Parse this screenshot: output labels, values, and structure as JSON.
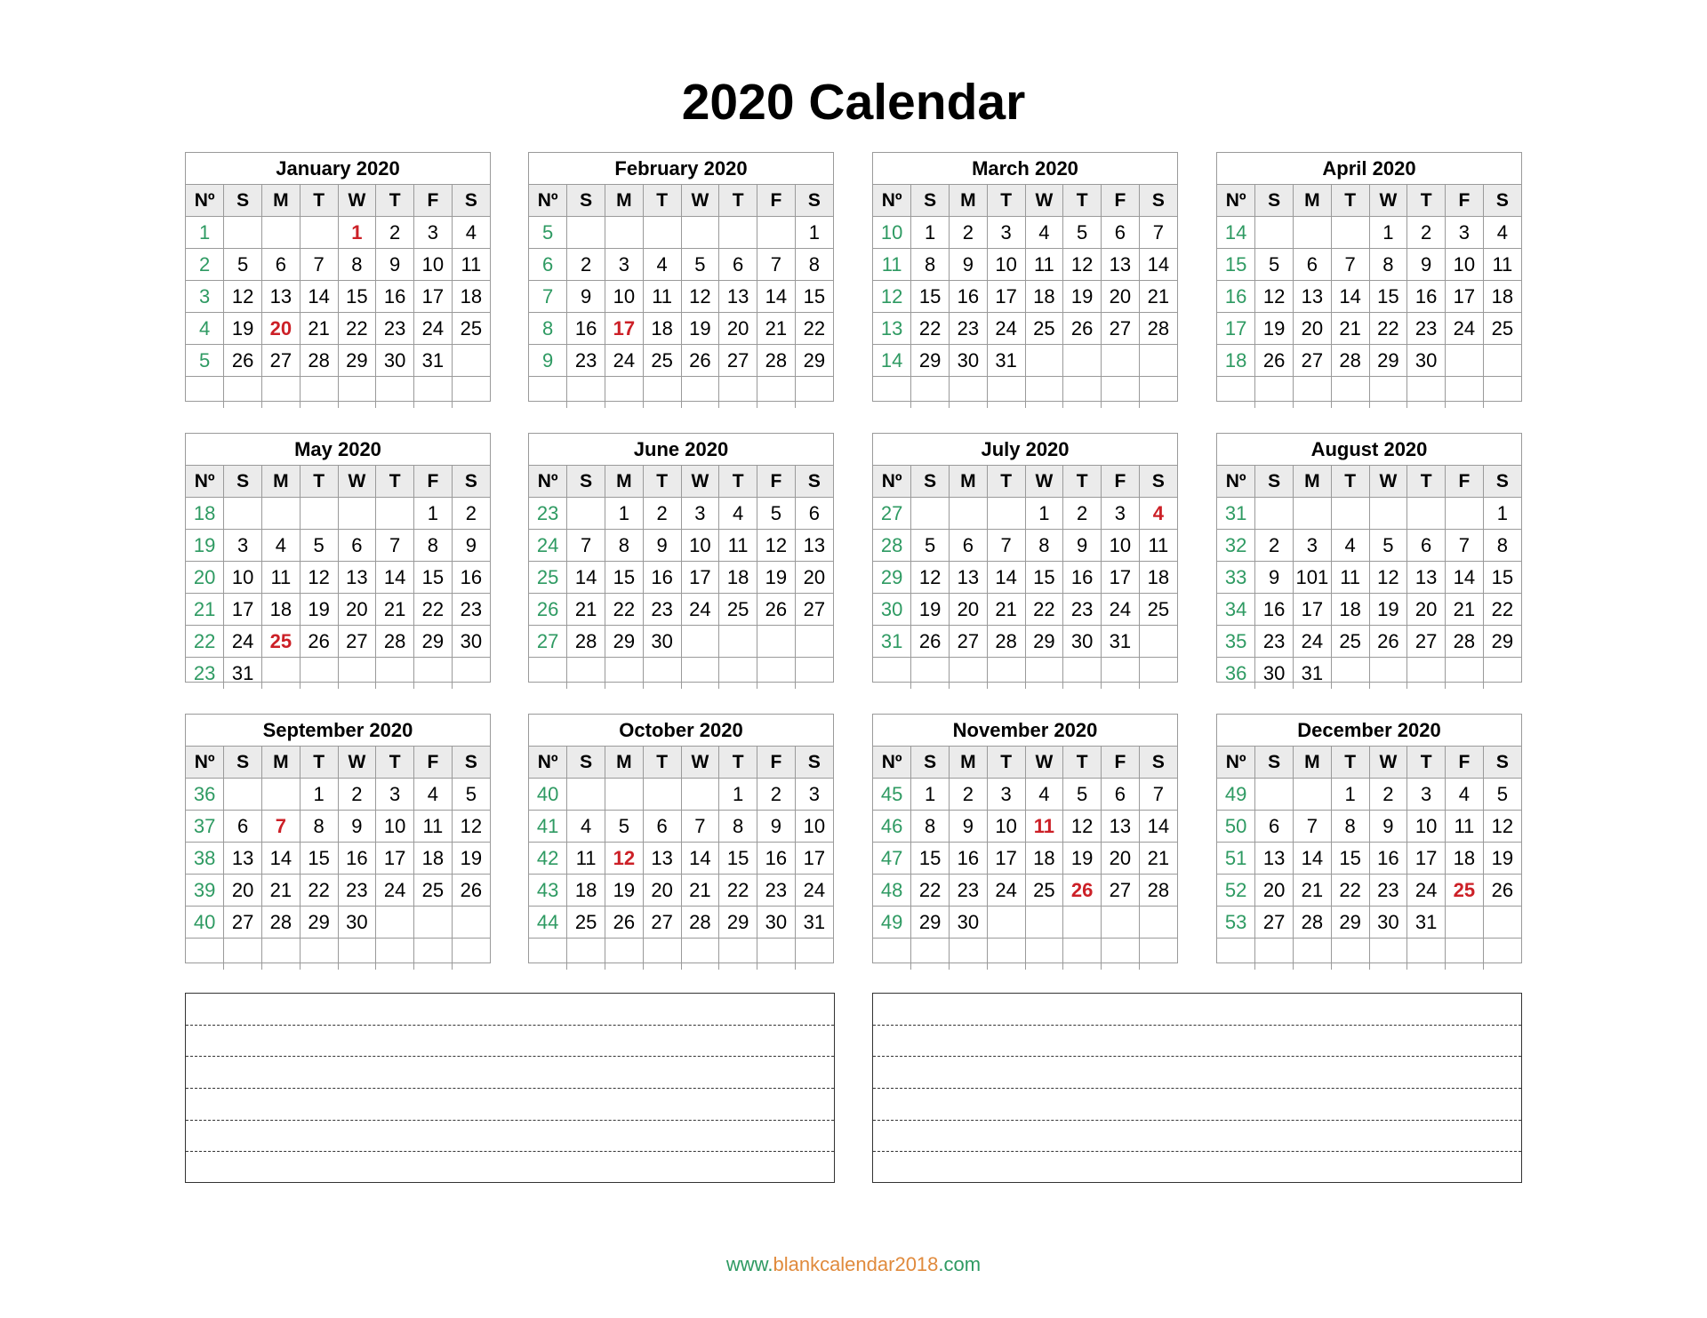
{
  "title": "2020 Calendar",
  "weekday_headers": [
    "Nº",
    "S",
    "M",
    "T",
    "W",
    "T",
    "F",
    "S"
  ],
  "colors": {
    "week_number": "#2e9a62",
    "holiday": "#cc2027",
    "header_bg": "#ebebeb",
    "border": "#9a9a9a"
  },
  "months": [
    {
      "name": "January 2020",
      "weeks": [
        [
          1,
          "",
          "",
          "",
          "1",
          "2",
          "3",
          "4"
        ],
        [
          2,
          "5",
          "6",
          "7",
          "8",
          "9",
          "10",
          "11"
        ],
        [
          3,
          "12",
          "13",
          "14",
          "15",
          "16",
          "17",
          "18"
        ],
        [
          4,
          "19",
          "20",
          "21",
          "22",
          "23",
          "24",
          "25"
        ],
        [
          5,
          "26",
          "27",
          "28",
          "29",
          "30",
          "31",
          ""
        ],
        [
          "",
          "",
          "",
          "",
          "",
          "",
          "",
          ""
        ]
      ],
      "holidays": [
        "1",
        "20"
      ]
    },
    {
      "name": "February 2020",
      "weeks": [
        [
          5,
          "",
          "",
          "",
          "",
          "",
          "",
          "1"
        ],
        [
          6,
          "2",
          "3",
          "4",
          "5",
          "6",
          "7",
          "8"
        ],
        [
          7,
          "9",
          "10",
          "11",
          "12",
          "13",
          "14",
          "15"
        ],
        [
          8,
          "16",
          "17",
          "18",
          "19",
          "20",
          "21",
          "22"
        ],
        [
          9,
          "23",
          "24",
          "25",
          "26",
          "27",
          "28",
          "29"
        ],
        [
          "",
          "",
          "",
          "",
          "",
          "",
          "",
          ""
        ]
      ],
      "holidays": [
        "17"
      ]
    },
    {
      "name": "March 2020",
      "weeks": [
        [
          10,
          "1",
          "2",
          "3",
          "4",
          "5",
          "6",
          "7"
        ],
        [
          11,
          "8",
          "9",
          "10",
          "11",
          "12",
          "13",
          "14"
        ],
        [
          12,
          "15",
          "16",
          "17",
          "18",
          "19",
          "20",
          "21"
        ],
        [
          13,
          "22",
          "23",
          "24",
          "25",
          "26",
          "27",
          "28"
        ],
        [
          14,
          "29",
          "30",
          "31",
          "",
          "",
          "",
          ""
        ],
        [
          "",
          "",
          "",
          "",
          "",
          "",
          "",
          ""
        ]
      ],
      "holidays": []
    },
    {
      "name": "April 2020",
      "weeks": [
        [
          14,
          "",
          "",
          "",
          "1",
          "2",
          "3",
          "4"
        ],
        [
          15,
          "5",
          "6",
          "7",
          "8",
          "9",
          "10",
          "11"
        ],
        [
          16,
          "12",
          "13",
          "14",
          "15",
          "16",
          "17",
          "18"
        ],
        [
          17,
          "19",
          "20",
          "21",
          "22",
          "23",
          "24",
          "25"
        ],
        [
          18,
          "26",
          "27",
          "28",
          "29",
          "30",
          "",
          ""
        ],
        [
          "",
          "",
          "",
          "",
          "",
          "",
          "",
          ""
        ]
      ],
      "holidays": []
    },
    {
      "name": "May 2020",
      "weeks": [
        [
          18,
          "",
          "",
          "",
          "",
          "",
          "1",
          "2"
        ],
        [
          19,
          "3",
          "4",
          "5",
          "6",
          "7",
          "8",
          "9"
        ],
        [
          20,
          "10",
          "11",
          "12",
          "13",
          "14",
          "15",
          "16"
        ],
        [
          21,
          "17",
          "18",
          "19",
          "20",
          "21",
          "22",
          "23"
        ],
        [
          22,
          "24",
          "25",
          "26",
          "27",
          "28",
          "29",
          "30"
        ],
        [
          23,
          "31",
          "",
          "",
          "",
          "",
          "",
          ""
        ]
      ],
      "holidays": [
        "25"
      ]
    },
    {
      "name": "June 2020",
      "weeks": [
        [
          23,
          "",
          "1",
          "2",
          "3",
          "4",
          "5",
          "6"
        ],
        [
          24,
          "7",
          "8",
          "9",
          "10",
          "11",
          "12",
          "13"
        ],
        [
          25,
          "14",
          "15",
          "16",
          "17",
          "18",
          "19",
          "20"
        ],
        [
          26,
          "21",
          "22",
          "23",
          "24",
          "25",
          "26",
          "27"
        ],
        [
          27,
          "28",
          "29",
          "30",
          "",
          "",
          "",
          ""
        ],
        [
          "",
          "",
          "",
          "",
          "",
          "",
          "",
          ""
        ]
      ],
      "holidays": []
    },
    {
      "name": "July 2020",
      "weeks": [
        [
          27,
          "",
          "",
          "",
          "1",
          "2",
          "3",
          "4"
        ],
        [
          28,
          "5",
          "6",
          "7",
          "8",
          "9",
          "10",
          "11"
        ],
        [
          29,
          "12",
          "13",
          "14",
          "15",
          "16",
          "17",
          "18"
        ],
        [
          30,
          "19",
          "20",
          "21",
          "22",
          "23",
          "24",
          "25"
        ],
        [
          31,
          "26",
          "27",
          "28",
          "29",
          "30",
          "31",
          ""
        ],
        [
          "",
          "",
          "",
          "",
          "",
          "",
          "",
          ""
        ]
      ],
      "holidays": [
        "4"
      ]
    },
    {
      "name": "August 2020",
      "weeks": [
        [
          31,
          "",
          "",
          "",
          "",
          "",
          "",
          "1"
        ],
        [
          32,
          "2",
          "3",
          "4",
          "5",
          "6",
          "7",
          "8"
        ],
        [
          33,
          "9",
          "101",
          "11",
          "12",
          "13",
          "14",
          "15"
        ],
        [
          34,
          "16",
          "17",
          "18",
          "19",
          "20",
          "21",
          "22"
        ],
        [
          35,
          "23",
          "24",
          "25",
          "26",
          "27",
          "28",
          "29"
        ],
        [
          36,
          "30",
          "31",
          "",
          "",
          "",
          "",
          ""
        ]
      ],
      "holidays": []
    },
    {
      "name": "September 2020",
      "weeks": [
        [
          36,
          "",
          "",
          "1",
          "2",
          "3",
          "4",
          "5"
        ],
        [
          37,
          "6",
          "7",
          "8",
          "9",
          "10",
          "11",
          "12"
        ],
        [
          38,
          "13",
          "14",
          "15",
          "16",
          "17",
          "18",
          "19"
        ],
        [
          39,
          "20",
          "21",
          "22",
          "23",
          "24",
          "25",
          "26"
        ],
        [
          40,
          "27",
          "28",
          "29",
          "30",
          "",
          "",
          ""
        ],
        [
          "",
          "",
          "",
          "",
          "",
          "",
          "",
          ""
        ]
      ],
      "holidays": [
        "7"
      ]
    },
    {
      "name": "October 2020",
      "weeks": [
        [
          40,
          "",
          "",
          "",
          "",
          "1",
          "2",
          "3"
        ],
        [
          41,
          "4",
          "5",
          "6",
          "7",
          "8",
          "9",
          "10"
        ],
        [
          42,
          "11",
          "12",
          "13",
          "14",
          "15",
          "16",
          "17"
        ],
        [
          43,
          "18",
          "19",
          "20",
          "21",
          "22",
          "23",
          "24"
        ],
        [
          44,
          "25",
          "26",
          "27",
          "28",
          "29",
          "30",
          "31"
        ],
        [
          "",
          "",
          "",
          "",
          "",
          "",
          "",
          ""
        ]
      ],
      "holidays": [
        "12"
      ]
    },
    {
      "name": "November 2020",
      "weeks": [
        [
          45,
          "1",
          "2",
          "3",
          "4",
          "5",
          "6",
          "7"
        ],
        [
          46,
          "8",
          "9",
          "10",
          "11",
          "12",
          "13",
          "14"
        ],
        [
          47,
          "15",
          "16",
          "17",
          "18",
          "19",
          "20",
          "21"
        ],
        [
          48,
          "22",
          "23",
          "24",
          "25",
          "26",
          "27",
          "28"
        ],
        [
          49,
          "29",
          "30",
          "",
          "",
          "",
          "",
          ""
        ],
        [
          "",
          "",
          "",
          "",
          "",
          "",
          "",
          ""
        ]
      ],
      "holidays": [
        "11",
        "26"
      ]
    },
    {
      "name": "December 2020",
      "weeks": [
        [
          49,
          "",
          "",
          "1",
          "2",
          "3",
          "4",
          "5"
        ],
        [
          50,
          "6",
          "7",
          "8",
          "9",
          "10",
          "11",
          "12"
        ],
        [
          51,
          "13",
          "14",
          "15",
          "16",
          "17",
          "18",
          "19"
        ],
        [
          52,
          "20",
          "21",
          "22",
          "23",
          "24",
          "25",
          "26"
        ],
        [
          53,
          "27",
          "28",
          "29",
          "30",
          "31",
          "",
          ""
        ],
        [
          "",
          "",
          "",
          "",
          "",
          "",
          "",
          ""
        ]
      ],
      "holidays": [
        "25"
      ]
    }
  ],
  "notes": {
    "boxes": 2,
    "lines_per_box": 6
  },
  "footer": {
    "prefix": "www.",
    "domain": "blankcalendar2018",
    "suffix": ".com"
  }
}
